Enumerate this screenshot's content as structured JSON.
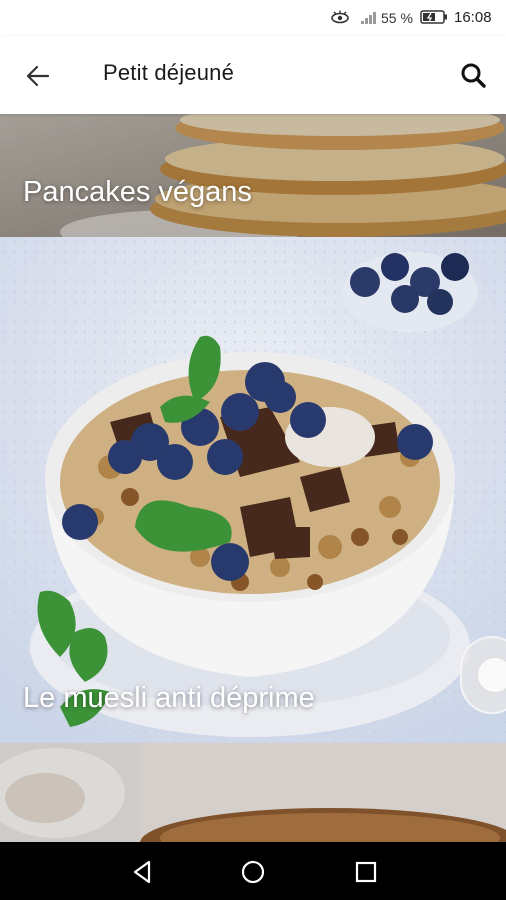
{
  "status_bar": {
    "battery_percent": "55 %",
    "time": "16:08",
    "icons": [
      "eye-comfort-icon",
      "signal-icon",
      "battery-icon"
    ]
  },
  "app_bar": {
    "title": "Petit déjeuné",
    "back_icon": "arrow-back-icon",
    "search_icon": "search-icon"
  },
  "recipes": [
    {
      "title": "Pancakes végans"
    },
    {
      "title": "Le muesli anti déprime"
    },
    {
      "title": ""
    }
  ],
  "nav_bar": {
    "icons": [
      "back-triangle-icon",
      "home-circle-icon",
      "recents-square-icon"
    ]
  },
  "colors": {
    "background": "#ffffff",
    "nav_bar": "#000000",
    "title_text": "#1a1a1a",
    "card_text": "#ffffff"
  }
}
